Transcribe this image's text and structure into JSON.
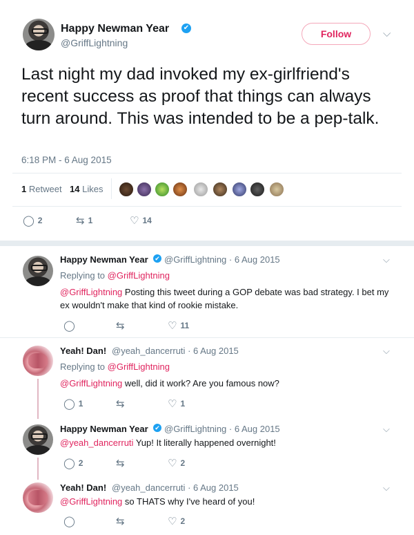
{
  "main_tweet": {
    "display_name": "Happy Newman Year",
    "handle": "@GriffLightning",
    "follow_label": "Follow",
    "text": "Last night my dad invoked my ex-girlfriend's recent success as proof that things can always turn around. This was intended to be a pep-talk.",
    "timestamp": "6:18 PM - 6 Aug 2015",
    "retweets_count": "1",
    "retweets_label": "Retweet",
    "likes_count": "14",
    "likes_label": "Likes",
    "actions": {
      "replies": "2",
      "retweets": "1",
      "likes": "14"
    }
  },
  "replies": [
    {
      "display_name": "Happy Newman Year",
      "handle": "@GriffLightning",
      "date": "· 6 Aug 2015",
      "replying_label": "Replying to ",
      "replying_to": "@GriffLightning",
      "mention": "@GriffLightning",
      "text": " Posting this tweet during a GOP debate was bad strategy. I bet my ex wouldn't make that kind of rookie mistake.",
      "actions": {
        "replies": "",
        "retweets": "",
        "likes": "11"
      }
    },
    {
      "display_name": "Yeah! Dan!",
      "handle": "@yeah_dancerruti",
      "date": "· 6 Aug 2015",
      "replying_label": "Replying to ",
      "replying_to": "@GriffLightning",
      "mention": "@GriffLightning",
      "text": " well, did it work? Are you famous now?",
      "actions": {
        "replies": "1",
        "retweets": "",
        "likes": "1"
      }
    },
    {
      "display_name": "Happy Newman Year",
      "handle": "@GriffLightning",
      "date": "· 6 Aug 2015",
      "mention": "@yeah_dancerruti",
      "text": " Yup! It literally happened overnight!",
      "actions": {
        "replies": "2",
        "retweets": "",
        "likes": "2"
      }
    },
    {
      "display_name": "Yeah! Dan!",
      "handle": "@yeah_dancerruti",
      "date": "· 6 Aug 2015",
      "mention": "@GriffLightning",
      "text": " so THATS why I've heard of you!",
      "actions": {
        "replies": "",
        "retweets": "",
        "likes": "2"
      }
    }
  ],
  "icons": {
    "verified": "✔",
    "chevron": "⌵",
    "reply": "◯",
    "retweet": "⇆",
    "like": "♡"
  },
  "colors": {
    "accent": "#e0245e",
    "verified": "#1da1f2",
    "muted": "#657786"
  }
}
